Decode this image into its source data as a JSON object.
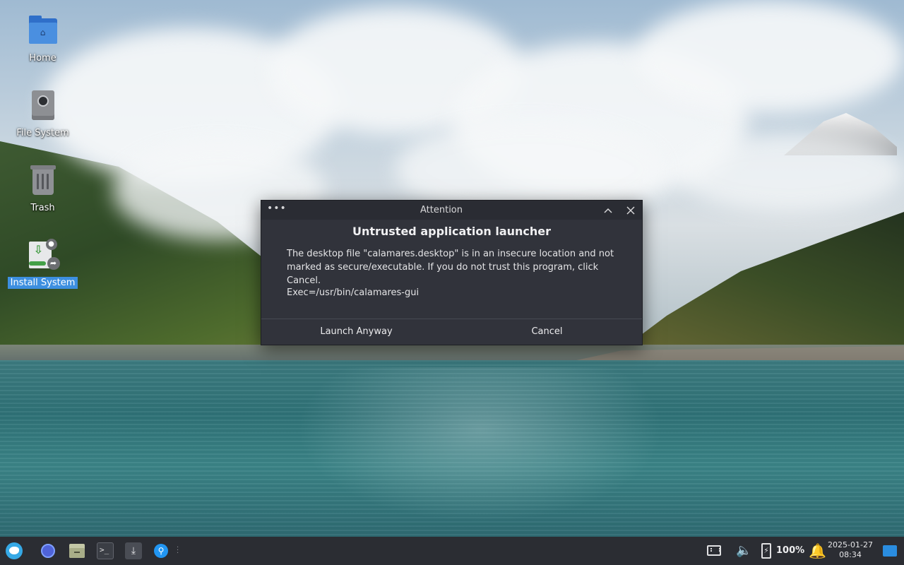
{
  "desktop": {
    "icons": [
      {
        "label": "Home"
      },
      {
        "label": "File System"
      },
      {
        "label": "Trash"
      },
      {
        "label": "Install System"
      }
    ]
  },
  "dialog": {
    "title": "Attention",
    "heading": "Untrusted application launcher",
    "message": "The desktop file \"calamares.desktop\" is in an insecure location and not marked as secure/executable. If you do not trust this program, click Cancel.",
    "exec_line": "Exec=/usr/bin/calamares-gui",
    "launch_label": "Launch Anyway",
    "cancel_label": "Cancel"
  },
  "taskbar": {
    "battery_label": "100%",
    "clock_date": "2025-01-27",
    "clock_time": "08:34"
  },
  "colors": {
    "selection": "#3d8fe0",
    "dialog_bg": "#31333b",
    "taskbar_bg": "#2b2d33",
    "accent": "#2196f3"
  }
}
